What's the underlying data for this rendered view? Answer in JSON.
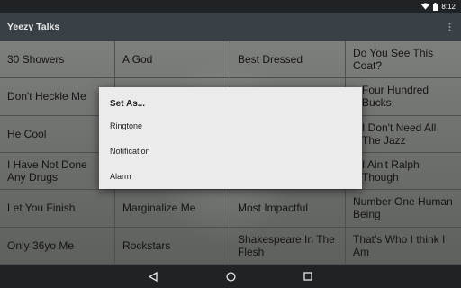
{
  "status_bar": {
    "time": "8:12",
    "icons": [
      "wifi-icon",
      "battery-icon"
    ]
  },
  "action_bar": {
    "title": "Yeezy Talks",
    "overflow_icon": "overflow-menu-icon"
  },
  "grid": {
    "cells": [
      "30 Showers",
      "A God",
      "Best Dressed",
      "Do You See This Coat?",
      "Don't Heckle Me",
      "",
      "",
      "Four Hundred Bucks",
      "He Cool",
      "",
      "",
      "I Don't Need All The Jazz",
      "I Have Not Done Any Drugs",
      "",
      "",
      "I Ain't Ralph Though",
      "Let You Finish",
      "Marginalize Me",
      "Most Impactful",
      "Number One Human Being",
      "Only 36yo Me",
      "Rockstars",
      "Shakespeare In The Flesh",
      "That's Who I think I Am"
    ]
  },
  "dialog": {
    "title": "Set As...",
    "items": [
      "Ringtone",
      "Notification",
      "Alarm"
    ]
  },
  "nav_bar": {
    "icons": [
      "back-icon",
      "home-icon",
      "recent-apps-icon"
    ]
  },
  "colors": {
    "status_bar": "#1f2326",
    "action_bar": "#3a4146",
    "dialog_bg": "#ebebeb",
    "grid_text": "#141414"
  }
}
